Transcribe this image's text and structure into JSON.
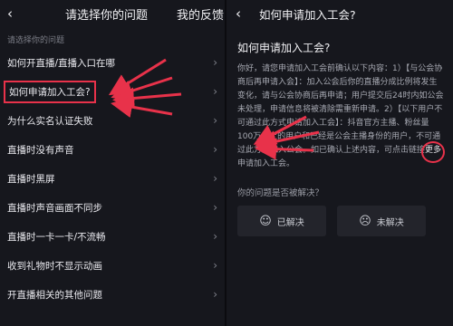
{
  "left": {
    "header": {
      "title": "请选择你的问题",
      "right": "我的反馈"
    },
    "section_label": "请选择你的问题",
    "items": [
      "如何开直播/直播入口在哪",
      "如何申请加入工会?",
      "为什么实名认证失败",
      "直播时没有声音",
      "直播时黑屏",
      "直播时声音画面不同步",
      "直播时一卡一卡/不流畅",
      "收到礼物时不显示动画",
      "开直播相关的其他问题"
    ]
  },
  "right": {
    "header": {
      "title": "如何申请加入工会?"
    },
    "question": "如何申请加入工会?",
    "answer": "你好，请您申请加入工会前确认以下内容：1）【与公会协商后再申请入会】：加入公会后你的直播分成比例将发生变化，请与公会协商后再申请；用户提交后24时内如公会未处理，申请信息将被清除需重新申请。2）【以下用户不可通过此方式申请加入工会】：抖音官方主播、粉丝量100万以上的用户和已经是公会主播身份的用户，不可通过此方式加入公会。如已确认上述内容，可点击链接",
    "more": "更多",
    "answer_tail": "申请加入工会。",
    "resolved_q": "你的问题是否被解决？",
    "resolved_btn": "已解决",
    "unresolved_btn": "未解决"
  },
  "colors": {
    "annotation": "#e8324a",
    "background": "#16171d"
  }
}
